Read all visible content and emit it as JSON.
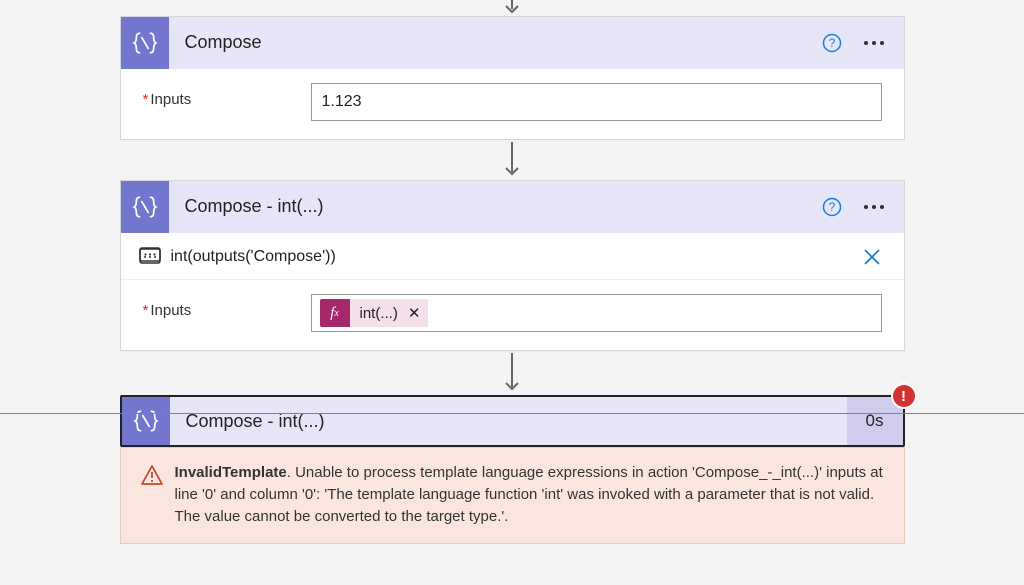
{
  "colors": {
    "header_bg": "#e7e5f8",
    "icon_bg": "#7376cf",
    "error_bg": "#fbe6df",
    "error_line": "#e05a5a",
    "fx_badge": "#a6276a"
  },
  "card1": {
    "title": "Compose",
    "inputs_label": "Inputs",
    "inputs_value": "1.123"
  },
  "card2": {
    "title": "Compose - int(...)",
    "peek_code": "int(outputs('Compose'))",
    "inputs_label": "Inputs",
    "token_label": "int(...)"
  },
  "run": {
    "title": "Compose - int(...)",
    "duration": "0s"
  },
  "error": {
    "title": "InvalidTemplate",
    "message": ". Unable to process template language expressions in action 'Compose_-_int(...)' inputs at line '0' and column '0': 'The template language function 'int' was invoked with a parameter that is not valid. The value cannot be converted to the target type.'."
  },
  "icons": {
    "compose": "compose-icon",
    "help": "help-icon",
    "more": "more-icon",
    "code_peek": "code-peek-icon",
    "close": "close-icon",
    "fx": "fx-icon",
    "warning": "warning-icon",
    "error_badge": "error-badge-icon",
    "arrow": "arrow-down-icon"
  }
}
